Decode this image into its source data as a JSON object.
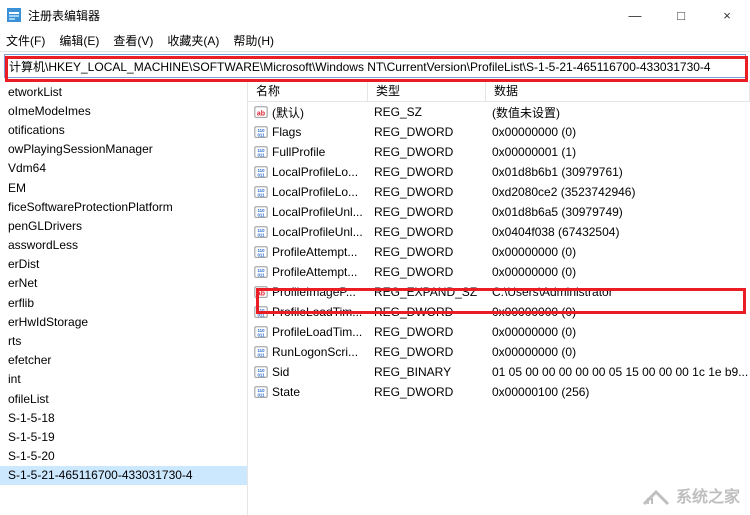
{
  "window": {
    "title": "注册表编辑器",
    "minimize": "—",
    "maximize": "□",
    "close": "×"
  },
  "menu": {
    "file": "文件(F)",
    "edit": "编辑(E)",
    "view": "查看(V)",
    "fav": "收藏夹(A)",
    "help": "帮助(H)"
  },
  "address": "计算机\\HKEY_LOCAL_MACHINE\\SOFTWARE\\Microsoft\\Windows NT\\CurrentVersion\\ProfileList\\S-1-5-21-465116700-433031730-4",
  "tree": [
    "etworkList",
    "oImeModeImes",
    "otifications",
    "owPlayingSessionManager",
    "Vdm64",
    "EM",
    "ficeSoftwareProtectionPlatform",
    "penGLDrivers",
    "asswordLess",
    "erDist",
    "erNet",
    "erflib",
    "erHwIdStorage",
    "rts",
    "efetcher",
    "int",
    "ofileList",
    "S-1-5-18",
    "S-1-5-19",
    "S-1-5-20",
    "S-1-5-21-465116700-433031730-4"
  ],
  "tree_selected": 20,
  "columns": {
    "name": "名称",
    "type": "类型",
    "data": "数据"
  },
  "values": [
    {
      "icon": "sz",
      "name": "(默认)",
      "type": "REG_SZ",
      "data": "(数值未设置)"
    },
    {
      "icon": "bin",
      "name": "Flags",
      "type": "REG_DWORD",
      "data": "0x00000000 (0)"
    },
    {
      "icon": "bin",
      "name": "FullProfile",
      "type": "REG_DWORD",
      "data": "0x00000001 (1)"
    },
    {
      "icon": "bin",
      "name": "LocalProfileLo...",
      "type": "REG_DWORD",
      "data": "0x01d8b6b1 (30979761)"
    },
    {
      "icon": "bin",
      "name": "LocalProfileLo...",
      "type": "REG_DWORD",
      "data": "0xd2080ce2 (3523742946)"
    },
    {
      "icon": "bin",
      "name": "LocalProfileUnl...",
      "type": "REG_DWORD",
      "data": "0x01d8b6a5 (30979749)"
    },
    {
      "icon": "bin",
      "name": "LocalProfileUnl...",
      "type": "REG_DWORD",
      "data": "0x0404f038 (67432504)"
    },
    {
      "icon": "bin",
      "name": "ProfileAttempt...",
      "type": "REG_DWORD",
      "data": "0x00000000 (0)"
    },
    {
      "icon": "bin",
      "name": "ProfileAttempt...",
      "type": "REG_DWORD",
      "data": "0x00000000 (0)"
    },
    {
      "icon": "sz",
      "name": "ProfileImageP...",
      "type": "REG_EXPAND_SZ",
      "data": "C:\\Users\\Administrator"
    },
    {
      "icon": "bin",
      "name": "ProfileLoadTim...",
      "type": "REG_DWORD",
      "data": "0x00000000 (0)"
    },
    {
      "icon": "bin",
      "name": "ProfileLoadTim...",
      "type": "REG_DWORD",
      "data": "0x00000000 (0)"
    },
    {
      "icon": "bin",
      "name": "RunLogonScri...",
      "type": "REG_DWORD",
      "data": "0x00000000 (0)"
    },
    {
      "icon": "bin",
      "name": "Sid",
      "type": "REG_BINARY",
      "data": "01 05 00 00 00 00 00 05 15 00 00 00 1c 1e b9..."
    },
    {
      "icon": "bin",
      "name": "State",
      "type": "REG_DWORD",
      "data": "0x00000100 (256)"
    }
  ],
  "watermark": "系统之家"
}
